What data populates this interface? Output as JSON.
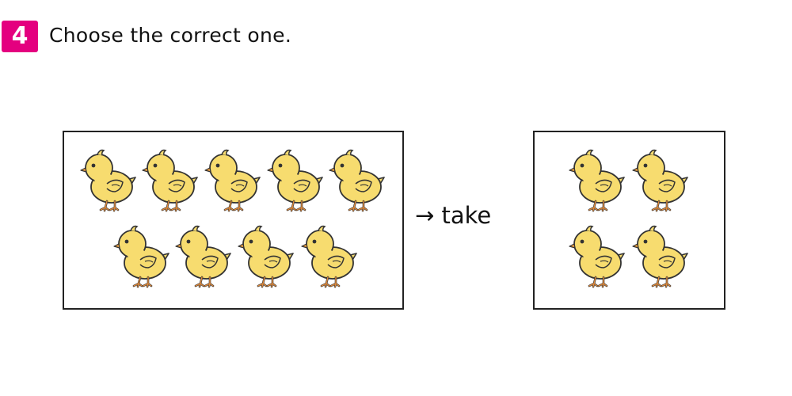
{
  "question": {
    "number": "4",
    "text": "Choose the correct one."
  },
  "operation": {
    "label": "→ take"
  },
  "left_group": {
    "item": "chick-icon",
    "count": 9
  },
  "right_group": {
    "item": "chick-icon",
    "count": 4
  },
  "colors": {
    "badge": "#e4007f",
    "chick_body": "#f7dc6f",
    "chick_outline": "#333333",
    "legs": "#e08a3c"
  }
}
